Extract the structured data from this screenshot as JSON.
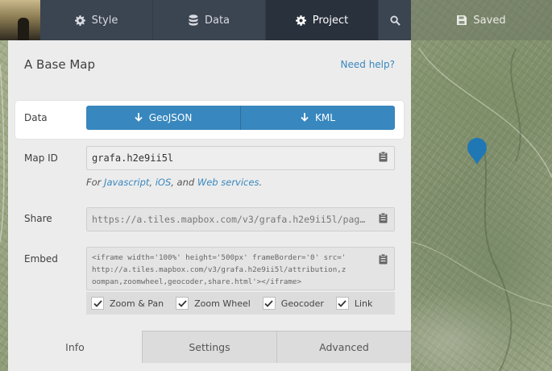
{
  "topbar": {
    "tabs": [
      {
        "label": "Style",
        "icon": "gear-icon"
      },
      {
        "label": "Data",
        "icon": "database-icon"
      },
      {
        "label": "Project",
        "icon": "gear-icon"
      }
    ],
    "search_icon": "search-icon",
    "saved_label": "Saved",
    "saved_icon": "floppy-disk-icon"
  },
  "panel": {
    "title": "A Base Map",
    "help_link": "Need help?",
    "data_row": {
      "label": "Data",
      "buttons": [
        {
          "label": "GeoJSON",
          "icon": "download-arrow-icon"
        },
        {
          "label": "KML",
          "icon": "download-arrow-icon"
        }
      ]
    },
    "map_id": {
      "label": "Map ID",
      "value": "grafa.h2e9ii5l"
    },
    "for_line": {
      "prefix": "For ",
      "link1": "Javascript",
      "sep1": ", ",
      "link2": "iOS",
      "sep2": ", and ",
      "link3": "Web services",
      "suffix": "."
    },
    "share": {
      "label": "Share",
      "value": "https://a.tiles.mapbox.com/v3/grafa.h2e9ii5l/pag…"
    },
    "embed": {
      "label": "Embed",
      "line1": "<iframe width='100%' height='500px' frameBorder='0' src='",
      "line2": "http://a.tiles.mapbox.com/v3/grafa.h2e9ii5l/attribution,z",
      "line3": "oompan,zoomwheel,geocoder,share.html'></iframe>",
      "options": [
        {
          "label": "Zoom & Pan",
          "checked": true
        },
        {
          "label": "Zoom Wheel",
          "checked": true
        },
        {
          "label": "Geocoder",
          "checked": true
        },
        {
          "label": "Link",
          "checked": true
        }
      ]
    },
    "bottom_tabs": [
      {
        "label": "Info",
        "active": true
      },
      {
        "label": "Settings",
        "active": false
      },
      {
        "label": "Advanced",
        "active": false
      }
    ]
  },
  "colors": {
    "accent": "#3887be",
    "topbar": "#3b4451",
    "panel": "#ececec",
    "marker": "#1f78b4"
  }
}
